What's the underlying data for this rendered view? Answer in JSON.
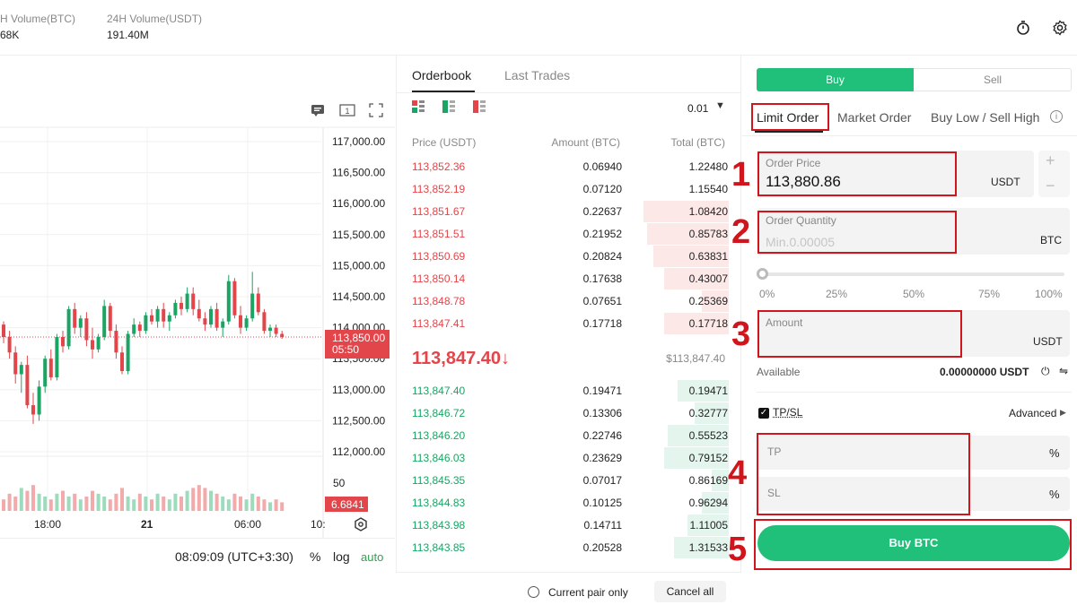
{
  "header": {
    "vol_btc_label": "H Volume(BTC)",
    "vol_btc_value": "68K",
    "vol_usdt_label": "24H Volume(USDT)",
    "vol_usdt_value": "191.40M",
    "timer_icon": "stopwatch-icon",
    "settings_icon": "gear-icon"
  },
  "chart": {
    "price_ticks": [
      "117,000.00",
      "116,500.00",
      "116,000.00",
      "115,500.00",
      "115,000.00",
      "114,500.00",
      "114,000.00",
      "113,500.00",
      "113,000.00",
      "112,500.00",
      "112,000.00"
    ],
    "last_price_tag": "113,850.00",
    "countdown_tag": "05:50",
    "volume_tick": "50",
    "volume_tag": "6.6841",
    "time_ticks": [
      "18:00",
      "21",
      "06:00",
      "10:"
    ],
    "clock": "08:09:09 (UTC+3:30)",
    "percent_label": "%",
    "log_label": "log",
    "auto_label": "auto",
    "colors": {
      "up": "#1ba464",
      "down": "#e2454a",
      "tag": "#e2454a"
    }
  },
  "chart_data": {
    "type": "candlestick",
    "title": "",
    "ylim": [
      112000,
      117000
    ],
    "last": 113850,
    "candles": [
      [
        114050,
        114100,
        113750,
        113850
      ],
      [
        113850,
        113950,
        113500,
        113600
      ],
      [
        113600,
        113700,
        113100,
        113250
      ],
      [
        113250,
        113450,
        112950,
        113400
      ],
      [
        113400,
        113550,
        112700,
        112750
      ],
      [
        112750,
        112950,
        112450,
        112600
      ],
      [
        112600,
        113150,
        112500,
        113050
      ],
      [
        113050,
        113550,
        112950,
        113500
      ],
      [
        113500,
        113650,
        113150,
        113200
      ],
      [
        113200,
        113900,
        113150,
        113850
      ],
      [
        113850,
        113950,
        113600,
        113700
      ],
      [
        113700,
        114350,
        113650,
        114300
      ],
      [
        114300,
        114400,
        113900,
        114000
      ],
      [
        114000,
        114200,
        113850,
        114150
      ],
      [
        114150,
        114250,
        113700,
        113800
      ],
      [
        113800,
        114000,
        113500,
        113650
      ],
      [
        113650,
        113900,
        113600,
        113850
      ],
      [
        113850,
        114450,
        113800,
        114350
      ],
      [
        114350,
        114400,
        113850,
        113950
      ],
      [
        113950,
        114050,
        113500,
        113600
      ],
      [
        113600,
        113700,
        113250,
        113300
      ],
      [
        113300,
        113950,
        113250,
        113900
      ],
      [
        113900,
        114150,
        113850,
        114050
      ],
      [
        114050,
        114100,
        113850,
        113950
      ],
      [
        113950,
        114250,
        113900,
        114200
      ],
      [
        114200,
        114300,
        114050,
        114100
      ],
      [
        114100,
        114350,
        114000,
        114300
      ],
      [
        114300,
        114400,
        114000,
        114100
      ],
      [
        114100,
        114250,
        113950,
        114200
      ],
      [
        114200,
        114450,
        114150,
        114400
      ],
      [
        114400,
        114500,
        114200,
        114300
      ],
      [
        114300,
        114650,
        114250,
        114550
      ],
      [
        114550,
        114650,
        114200,
        114300
      ],
      [
        114300,
        114450,
        114100,
        114150
      ],
      [
        114150,
        114250,
        113950,
        114050
      ],
      [
        114050,
        114350,
        114000,
        114300
      ],
      [
        114300,
        114400,
        113950,
        114000
      ],
      [
        114000,
        114150,
        113850,
        114100
      ],
      [
        114100,
        114850,
        114050,
        114750
      ],
      [
        114750,
        114800,
        114150,
        114200
      ],
      [
        114200,
        114350,
        113900,
        114000
      ],
      [
        114000,
        114200,
        113950,
        114150
      ],
      [
        114150,
        114900,
        114100,
        114550
      ],
      [
        114550,
        114650,
        114200,
        114250
      ],
      [
        114250,
        114300,
        113900,
        113950
      ],
      [
        113950,
        114050,
        113850,
        114000
      ],
      [
        114000,
        114050,
        113850,
        113900
      ],
      [
        113900,
        113950,
        113820,
        113850
      ]
    ],
    "volume": [
      4,
      6,
      5,
      8,
      7,
      9,
      6,
      5,
      4,
      6,
      7,
      5,
      6,
      4,
      5,
      7,
      6,
      5,
      4,
      6,
      8,
      5,
      4,
      6,
      5,
      4,
      6,
      5,
      4,
      6,
      5,
      7,
      8,
      9,
      8,
      7,
      6,
      5,
      4,
      6,
      5,
      4,
      6,
      5,
      4,
      3,
      4,
      3
    ]
  },
  "orderbook": {
    "tab_orderbook": "Orderbook",
    "tab_trades": "Last Trades",
    "precision": "0.01",
    "col_price": "Price (USDT)",
    "col_amount": "Amount (BTC)",
    "col_total": "Total (BTC)",
    "asks": [
      {
        "price": "113,852.36",
        "amount": "0.06940",
        "total": "1.22480",
        "depth": 0.0
      },
      {
        "price": "113,852.19",
        "amount": "0.07120",
        "total": "1.15540",
        "depth": 0.0
      },
      {
        "price": "113,851.67",
        "amount": "0.22637",
        "total": "1.08420",
        "depth": 0.25
      },
      {
        "price": "113,851.51",
        "amount": "0.21952",
        "total": "0.85783",
        "depth": 0.24
      },
      {
        "price": "113,850.69",
        "amount": "0.20824",
        "total": "0.63831",
        "depth": 0.22
      },
      {
        "price": "113,850.14",
        "amount": "0.17638",
        "total": "0.43007",
        "depth": 0.19
      },
      {
        "price": "113,848.78",
        "amount": "0.07651",
        "total": "0.25369",
        "depth": 0.08
      },
      {
        "price": "113,847.41",
        "amount": "0.17718",
        "total": "0.17718",
        "depth": 0.19
      }
    ],
    "mid_price": "113,847.40",
    "mid_arrow": "↓",
    "mid_usd": "$113,847.40",
    "bids": [
      {
        "price": "113,847.40",
        "amount": "0.19471",
        "total": "0.19471",
        "depth": 0.15
      },
      {
        "price": "113,846.72",
        "amount": "0.13306",
        "total": "0.32777",
        "depth": 0.1
      },
      {
        "price": "113,846.20",
        "amount": "0.22746",
        "total": "0.55523",
        "depth": 0.18
      },
      {
        "price": "113,846.03",
        "amount": "0.23629",
        "total": "0.79152",
        "depth": 0.19
      },
      {
        "price": "113,845.35",
        "amount": "0.07017",
        "total": "0.86169",
        "depth": 0.05
      },
      {
        "price": "113,844.83",
        "amount": "0.10125",
        "total": "0.96294",
        "depth": 0.08
      },
      {
        "price": "113,843.98",
        "amount": "0.14711",
        "total": "1.11005",
        "depth": 0.12
      },
      {
        "price": "113,843.85",
        "amount": "0.20528",
        "total": "1.31533",
        "depth": 0.16
      }
    ],
    "current_pair_only": "Current pair only",
    "cancel_all": "Cancel all"
  },
  "panel": {
    "buy_tab": "Buy",
    "sell_tab": "Sell",
    "limit_order": "Limit Order",
    "market_order": "Market Order",
    "buy_low_sell_high": "Buy Low / Sell High",
    "order_price_label": "Order Price",
    "order_price_value": "113,880.86",
    "order_price_unit": "USDT",
    "plus": "+",
    "minus": "−",
    "order_qty_label": "Order Quantity",
    "order_qty_placeholder": "Min.0.00005",
    "order_qty_unit": "BTC",
    "slider_marks": [
      "0%",
      "25%",
      "50%",
      "75%",
      "100%"
    ],
    "slider_level": 0,
    "amount_label": "Amount",
    "amount_unit": "USDT",
    "available_label": "Available",
    "available_value": "0.00000000 USDT",
    "tpsl_label": "TP/SL",
    "advanced_label": "Advanced",
    "tp_label": "TP",
    "tp_unit": "%",
    "sl_label": "SL",
    "sl_unit": "%",
    "buy_button": "Buy BTC",
    "accent": "#20c07a",
    "annotation_numbers": [
      "1",
      "2",
      "3",
      "4",
      "5"
    ]
  }
}
